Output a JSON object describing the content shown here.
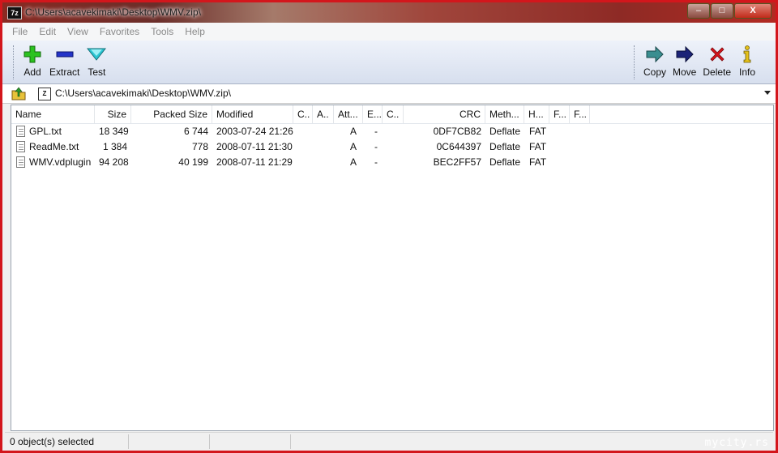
{
  "window": {
    "title": "C:\\Users\\acavekimaki\\Desktop\\WMV.zip\\",
    "app_icon_text": "7z",
    "min_label": "‒",
    "max_label": "□",
    "close_label": "X"
  },
  "menu": [
    "File",
    "Edit",
    "View",
    "Favorites",
    "Tools",
    "Help"
  ],
  "toolbar": {
    "left": [
      {
        "label": "Add",
        "icon": "plus-icon"
      },
      {
        "label": "Extract",
        "icon": "minus-icon"
      },
      {
        "label": "Test",
        "icon": "check-icon"
      }
    ],
    "right": [
      {
        "label": "Copy",
        "icon": "arrow-right-icon"
      },
      {
        "label": "Move",
        "icon": "arrow-right-dark-icon"
      },
      {
        "label": "Delete",
        "icon": "cross-icon"
      },
      {
        "label": "Info",
        "icon": "info-icon"
      }
    ]
  },
  "address": {
    "path": "C:\\Users\\acavekimaki\\Desktop\\WMV.zip\\",
    "icon_text": "Z"
  },
  "columns": [
    "Name",
    "Size",
    "Packed Size",
    "Modified",
    "C..",
    "A..",
    "Att...",
    "E...",
    "C..",
    "CRC",
    "Meth...",
    "H...",
    "F...",
    "F..."
  ],
  "files": [
    {
      "name": "GPL.txt",
      "size": "18 349",
      "packed": "6 744",
      "modified": "2003-07-24 21:26",
      "attr": "A",
      "enc": "-",
      "crc": "0DF7CB82",
      "method": "Deflate",
      "host": "FAT"
    },
    {
      "name": "ReadMe.txt",
      "size": "1 384",
      "packed": "778",
      "modified": "2008-07-11 21:30",
      "attr": "A",
      "enc": "-",
      "crc": "0C644397",
      "method": "Deflate",
      "host": "FAT"
    },
    {
      "name": "WMV.vdplugin",
      "size": "94 208",
      "packed": "40 199",
      "modified": "2008-07-11 21:29",
      "attr": "A",
      "enc": "-",
      "crc": "BEC2FF57",
      "method": "Deflate",
      "host": "FAT"
    }
  ],
  "status": {
    "selected": "0 object(s) selected"
  },
  "watermark": "mycity.rs"
}
